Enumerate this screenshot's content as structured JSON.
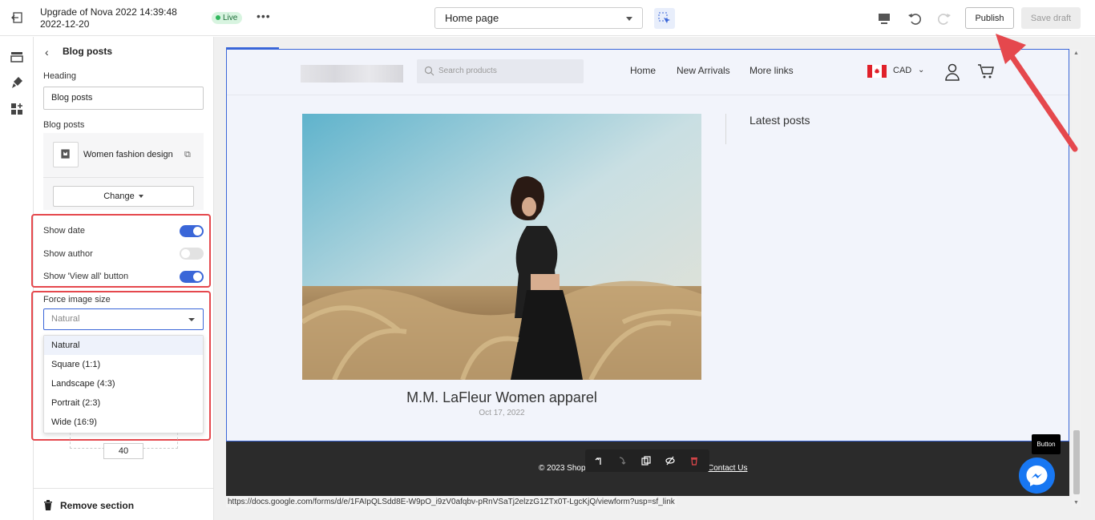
{
  "topbar": {
    "title": "Upgrade of Nova 2022 14:39:48 2022-12-20",
    "live_badge": "Live",
    "page_select": "Home page",
    "publish_label": "Publish",
    "save_draft_label": "Save draft"
  },
  "sidebar": {
    "title": "Blog posts",
    "heading_label": "Heading",
    "heading_value": "Blog posts",
    "blog_posts_label": "Blog posts",
    "post_name": "Women fashion design",
    "change_label": "Change",
    "show_date_label": "Show date",
    "show_date": true,
    "show_author_label": "Show author",
    "show_author": false,
    "show_view_all_label": "Show 'View all' button",
    "show_view_all": true,
    "force_image_label": "Force image size",
    "force_image_value": "Natural",
    "options": [
      "Natural",
      "Square (1:1)",
      "Landscape (4:3)",
      "Portrait (2:3)",
      "Wide (16:9)"
    ],
    "number_value": "40",
    "remove_section_label": "Remove section"
  },
  "store": {
    "search_placeholder": "Search products",
    "nav": [
      "Home",
      "New Arrivals",
      "More links"
    ],
    "currency": "CAD",
    "post_title": "M.M. LaFleur Women apparel",
    "post_date": "Oct 17, 2022",
    "latest_posts": "Latest posts",
    "footer_copy": "© 2023 Shop",
    "footer_contact": "Contact Us",
    "button_tooltip": "Button"
  },
  "status_url": "https://docs.google.com/forms/d/e/1FAIpQLSdd8E-W9pO_i9zV0afqbv-pRnVSaTj2elzzG1ZTx0T-LgcKjQ/viewform?usp=sf_link",
  "colors": {
    "accent": "#3a66d8",
    "highlight": "#e5484d",
    "live": "#2fb75c",
    "messenger": "#1877f2",
    "footer": "#2b2b2b"
  }
}
